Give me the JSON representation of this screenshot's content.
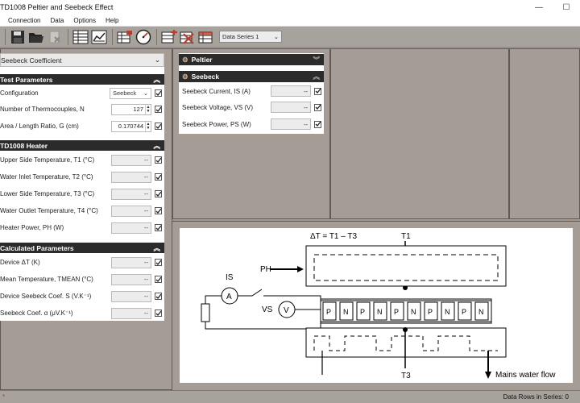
{
  "window": {
    "title": "TD1008 Peltier and Seebeck Effect",
    "minimize": "—",
    "maximize": "☐"
  },
  "menu": [
    "Connection",
    "Data",
    "Options",
    "Help"
  ],
  "toolbar": {
    "series_select": "Data Series 1"
  },
  "left_panel": {
    "mode_select": "Seebeck Coefficient",
    "test_parameters": {
      "header": "Test Parameters",
      "rows": [
        {
          "label": "Configuration",
          "value": "Seebeck"
        },
        {
          "label": "Number of Thermocouples, N",
          "value": "127"
        },
        {
          "label": "Area / Length Ratio, G (cm)",
          "value": "0.170744"
        }
      ]
    },
    "heater": {
      "header": "TD1008 Heater",
      "rows": [
        {
          "label": "Upper Side Temperature, T1 (°C)",
          "value": "--"
        },
        {
          "label": "Water Inlet Temperature, T2 (°C)",
          "value": "--"
        },
        {
          "label": "Lower Side Temperature, T3 (°C)",
          "value": "--"
        },
        {
          "label": "Water Outlet Temperature, T4 (°C)",
          "value": "--"
        },
        {
          "label": "Heater Power, PH (W)",
          "value": "--"
        }
      ]
    },
    "calculated": {
      "header": "Calculated Parameters",
      "rows": [
        {
          "label": "Device ΔT (K)",
          "value": "--"
        },
        {
          "label": "Mean Temperature, TMEAN (°C)",
          "value": "--"
        },
        {
          "label": "Device Seebeck Coef. S (V.K⁻¹)",
          "value": "--"
        },
        {
          "label": "Seebeck Coef. α (μV.K⁻¹)",
          "value": "--"
        }
      ]
    }
  },
  "right_panel": {
    "peltier_header": "Peltier",
    "seebeck_header": "Seebeck",
    "rows": [
      {
        "label": "Seebeck Current, IS (A)",
        "value": "--"
      },
      {
        "label": "Seebeck Voltage, VS (V)",
        "value": "--"
      },
      {
        "label": "Seebeck Power, PS (W)",
        "value": "--"
      }
    ]
  },
  "diagram": {
    "delta_t": "ΔT = T1 – T3",
    "t1": "T1",
    "t3": "T3",
    "ph": "PH",
    "is": "IS",
    "vs": "VS",
    "ammeter": "A",
    "voltmeter": "V",
    "legs": [
      "P",
      "N",
      "P",
      "N",
      "P",
      "N",
      "P",
      "N",
      "P",
      "N"
    ],
    "water": "Mains water flow"
  },
  "status": {
    "left": "*",
    "right": "Data Rows in Series: 0"
  }
}
